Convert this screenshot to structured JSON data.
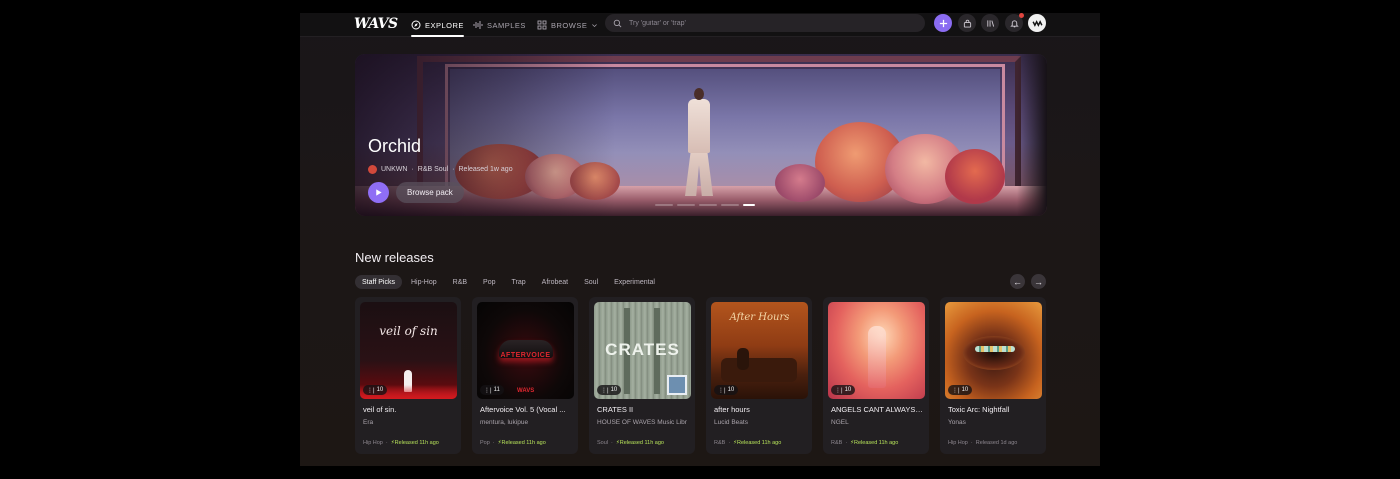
{
  "nav": {
    "logo": "WAVS",
    "links": [
      {
        "label": "EXPLORE",
        "icon": "compass-icon",
        "active": true
      },
      {
        "label": "SAMPLES",
        "icon": "waveform-icon",
        "active": false
      },
      {
        "label": "BROWSE",
        "icon": "grid-icon",
        "active": false
      }
    ],
    "search_placeholder": "Try 'guitar' or 'trap'",
    "accent": "#8b6cf2"
  },
  "hero": {
    "title": "Orchid",
    "artist": "UNKWN",
    "genre": "R&B Soul",
    "released": "Released 1w ago",
    "browse_label": "Browse pack",
    "slides": 5,
    "active_slide": 4
  },
  "releases": {
    "title": "New releases",
    "chips": [
      "Staff Picks",
      "Hip-Hop",
      "R&B",
      "Pop",
      "Trap",
      "Afrobeat",
      "Soul",
      "Experimental"
    ],
    "active_chip": 0,
    "cards": [
      {
        "title": "veil of sin.",
        "artist": "Era",
        "count": "10",
        "genre": "Hip Hop",
        "released": "Released 11h ago",
        "fresh": true,
        "cover_text": "veil of sin"
      },
      {
        "title": "Aftervoice Vol. 5 (Vocal ...",
        "artist": "mentura, lukipue",
        "count": "11",
        "genre": "Pop",
        "released": "Released 11h ago",
        "fresh": true,
        "cover_text": "AFTERVOICE"
      },
      {
        "title": "CRATES II",
        "artist": "HOUSE OF WAVES Music Libr",
        "count": "10",
        "genre": "Soul",
        "released": "Released 11h ago",
        "fresh": true,
        "cover_text": "CRATES"
      },
      {
        "title": "after hours",
        "artist": "Lucid Beats",
        "count": "10",
        "genre": "R&B",
        "released": "Released 11h ago",
        "fresh": true,
        "cover_text": "After Hours"
      },
      {
        "title": "ANGELS CANT ALWAYS ...",
        "artist": "NGEL",
        "count": "10",
        "genre": "R&B",
        "released": "Released 11h ago",
        "fresh": true,
        "cover_text": ""
      },
      {
        "title": "Toxic Arc: Nightfall",
        "artist": "Yonas",
        "count": "10",
        "genre": "Hip Hop",
        "released": "Released 1d ago",
        "fresh": false,
        "cover_text": ""
      }
    ]
  }
}
